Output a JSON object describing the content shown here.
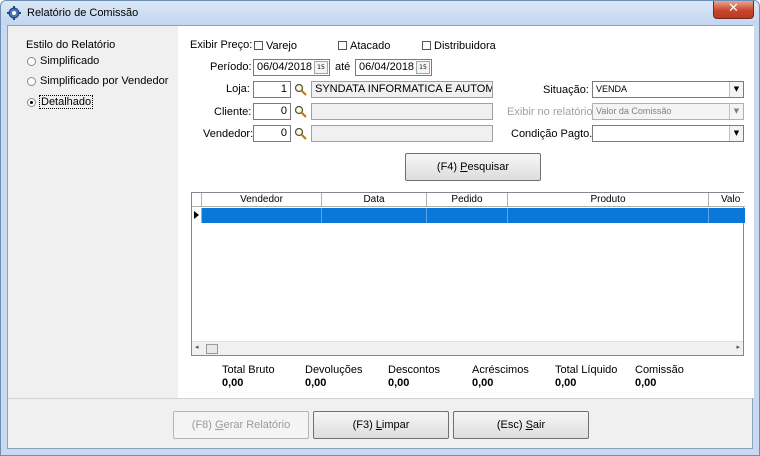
{
  "window": {
    "title": "Relatório de Comissão",
    "close": "✕"
  },
  "estilo": {
    "group_label": "Estilo do Relatório",
    "options": [
      "Simplificado",
      "Simplificado por Vendedor",
      "Detalhado"
    ],
    "selected": "Detalhado"
  },
  "exibir_preco": {
    "label": "Exibir Preço:",
    "options": [
      "Varejo",
      "Atacado",
      "Distribuidora"
    ]
  },
  "periodo": {
    "label": "Período:",
    "from": "06/04/2018",
    "ate_label": "até",
    "to": "06/04/2018",
    "cal_icon": "15"
  },
  "loja": {
    "label": "Loja:",
    "code": "1",
    "name": "SYNDATA INFORMATICA E AUTOMAC"
  },
  "cliente": {
    "label": "Cliente:",
    "code": "0",
    "name": ""
  },
  "vendedor": {
    "label": "Vendedor:",
    "code": "0",
    "name": ""
  },
  "situacao": {
    "label": "Situação:",
    "value": "VENDA"
  },
  "exibir_relatorio": {
    "label": "Exibir no relatório:",
    "value": "Valor da Comissão"
  },
  "condicao": {
    "label": "Condição Pagto.:",
    "value": ""
  },
  "search_button": {
    "prefix": "(F4) ",
    "ul": "P",
    "rest": "esquisar"
  },
  "grid": {
    "columns": [
      "Vendedor",
      "Data",
      "Pedido",
      "Produto",
      "Valo"
    ]
  },
  "totals": {
    "labels": [
      "Total Bruto",
      "Devoluções",
      "Descontos",
      "Acréscimos",
      "Total Líquido",
      "Comissão"
    ],
    "values": [
      "0,00",
      "0,00",
      "0,00",
      "0,00",
      "0,00",
      "0,00"
    ]
  },
  "buttons": {
    "gerar": {
      "prefix": "(F8) ",
      "ul": "G",
      "rest": "erar Relatório"
    },
    "limpar": {
      "prefix": "(F3) ",
      "ul": "L",
      "rest": "impar"
    },
    "sair": {
      "prefix": "(Esc) ",
      "ul": "S",
      "rest": "air"
    }
  },
  "colors": {
    "accent": "#0a78d8",
    "title_bar": "#c9daf0",
    "close": "#c9462c"
  }
}
